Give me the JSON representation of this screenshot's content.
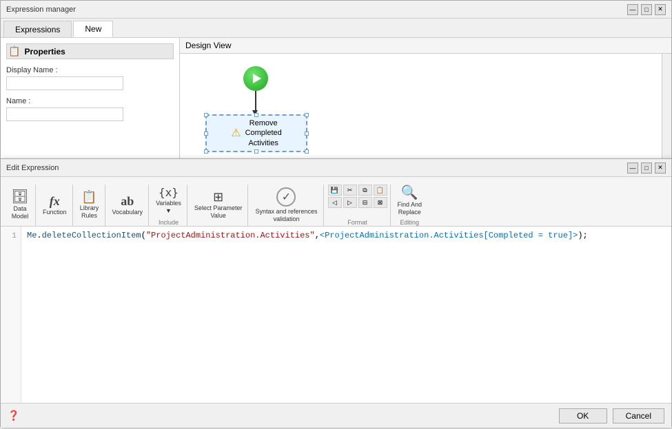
{
  "expressionManager": {
    "title": "Expression manager",
    "tabs": [
      {
        "id": "expressions",
        "label": "Expressions",
        "active": false
      },
      {
        "id": "new",
        "label": "New",
        "active": true
      }
    ],
    "properties": {
      "header": "Properties",
      "displayNameLabel": "Display Name :",
      "displayNameValue": "",
      "nameLabel": "Name :",
      "nameValue": ""
    },
    "designView": {
      "header": "Design View",
      "nodeName": "Remove\nCompleted\nActivities"
    }
  },
  "editExpression": {
    "title": "Edit Expression",
    "toolbar": {
      "groups": [
        {
          "id": "data-model",
          "buttons": [
            {
              "label": "Data\nModel",
              "icon": "🗄"
            }
          ]
        },
        {
          "id": "function",
          "buttons": [
            {
              "label": "Function",
              "icon": "fx"
            }
          ]
        },
        {
          "id": "library-rules",
          "buttons": [
            {
              "label": "Library\nRules",
              "icon": "📋"
            }
          ]
        },
        {
          "id": "vocabulary",
          "buttons": [
            {
              "label": "Vocabulary",
              "icon": "ab"
            }
          ]
        },
        {
          "id": "variables",
          "buttons": [
            {
              "label": "Variables",
              "icon": "{x}"
            }
          ],
          "label": "Include"
        },
        {
          "id": "select-parameter",
          "buttons": [
            {
              "label": "Select Parameter\nValue",
              "icon": "⊞"
            }
          ]
        },
        {
          "id": "syntax-validation",
          "buttons": [
            {
              "label": "Syntax and references\nvalidation",
              "icon": "✓"
            }
          ]
        },
        {
          "id": "format",
          "label": "Format",
          "buttons": [
            {
              "label": "",
              "icon": "💾"
            },
            {
              "label": "",
              "icon": "✂"
            },
            {
              "label": "",
              "icon": "📋"
            },
            {
              "label": "",
              "icon": "📄"
            },
            {
              "label": "",
              "icon": "◀"
            },
            {
              "label": "",
              "icon": "▶"
            },
            {
              "label": "",
              "icon": "⊟"
            },
            {
              "label": "",
              "icon": "⊠"
            }
          ]
        },
        {
          "id": "find-replace",
          "label": "Editing",
          "buttons": [
            {
              "label": "Find And\nReplace",
              "icon": "🔍"
            }
          ]
        }
      ]
    },
    "codeEditor": {
      "lines": [
        {
          "number": "1",
          "code": "Me.deleteCollectionItem(\"ProjectAdministration.Activities\",<ProjectAdministration.Activities[Completed = true]>);"
        }
      ]
    },
    "buttons": {
      "ok": "OK",
      "cancel": "Cancel"
    }
  }
}
